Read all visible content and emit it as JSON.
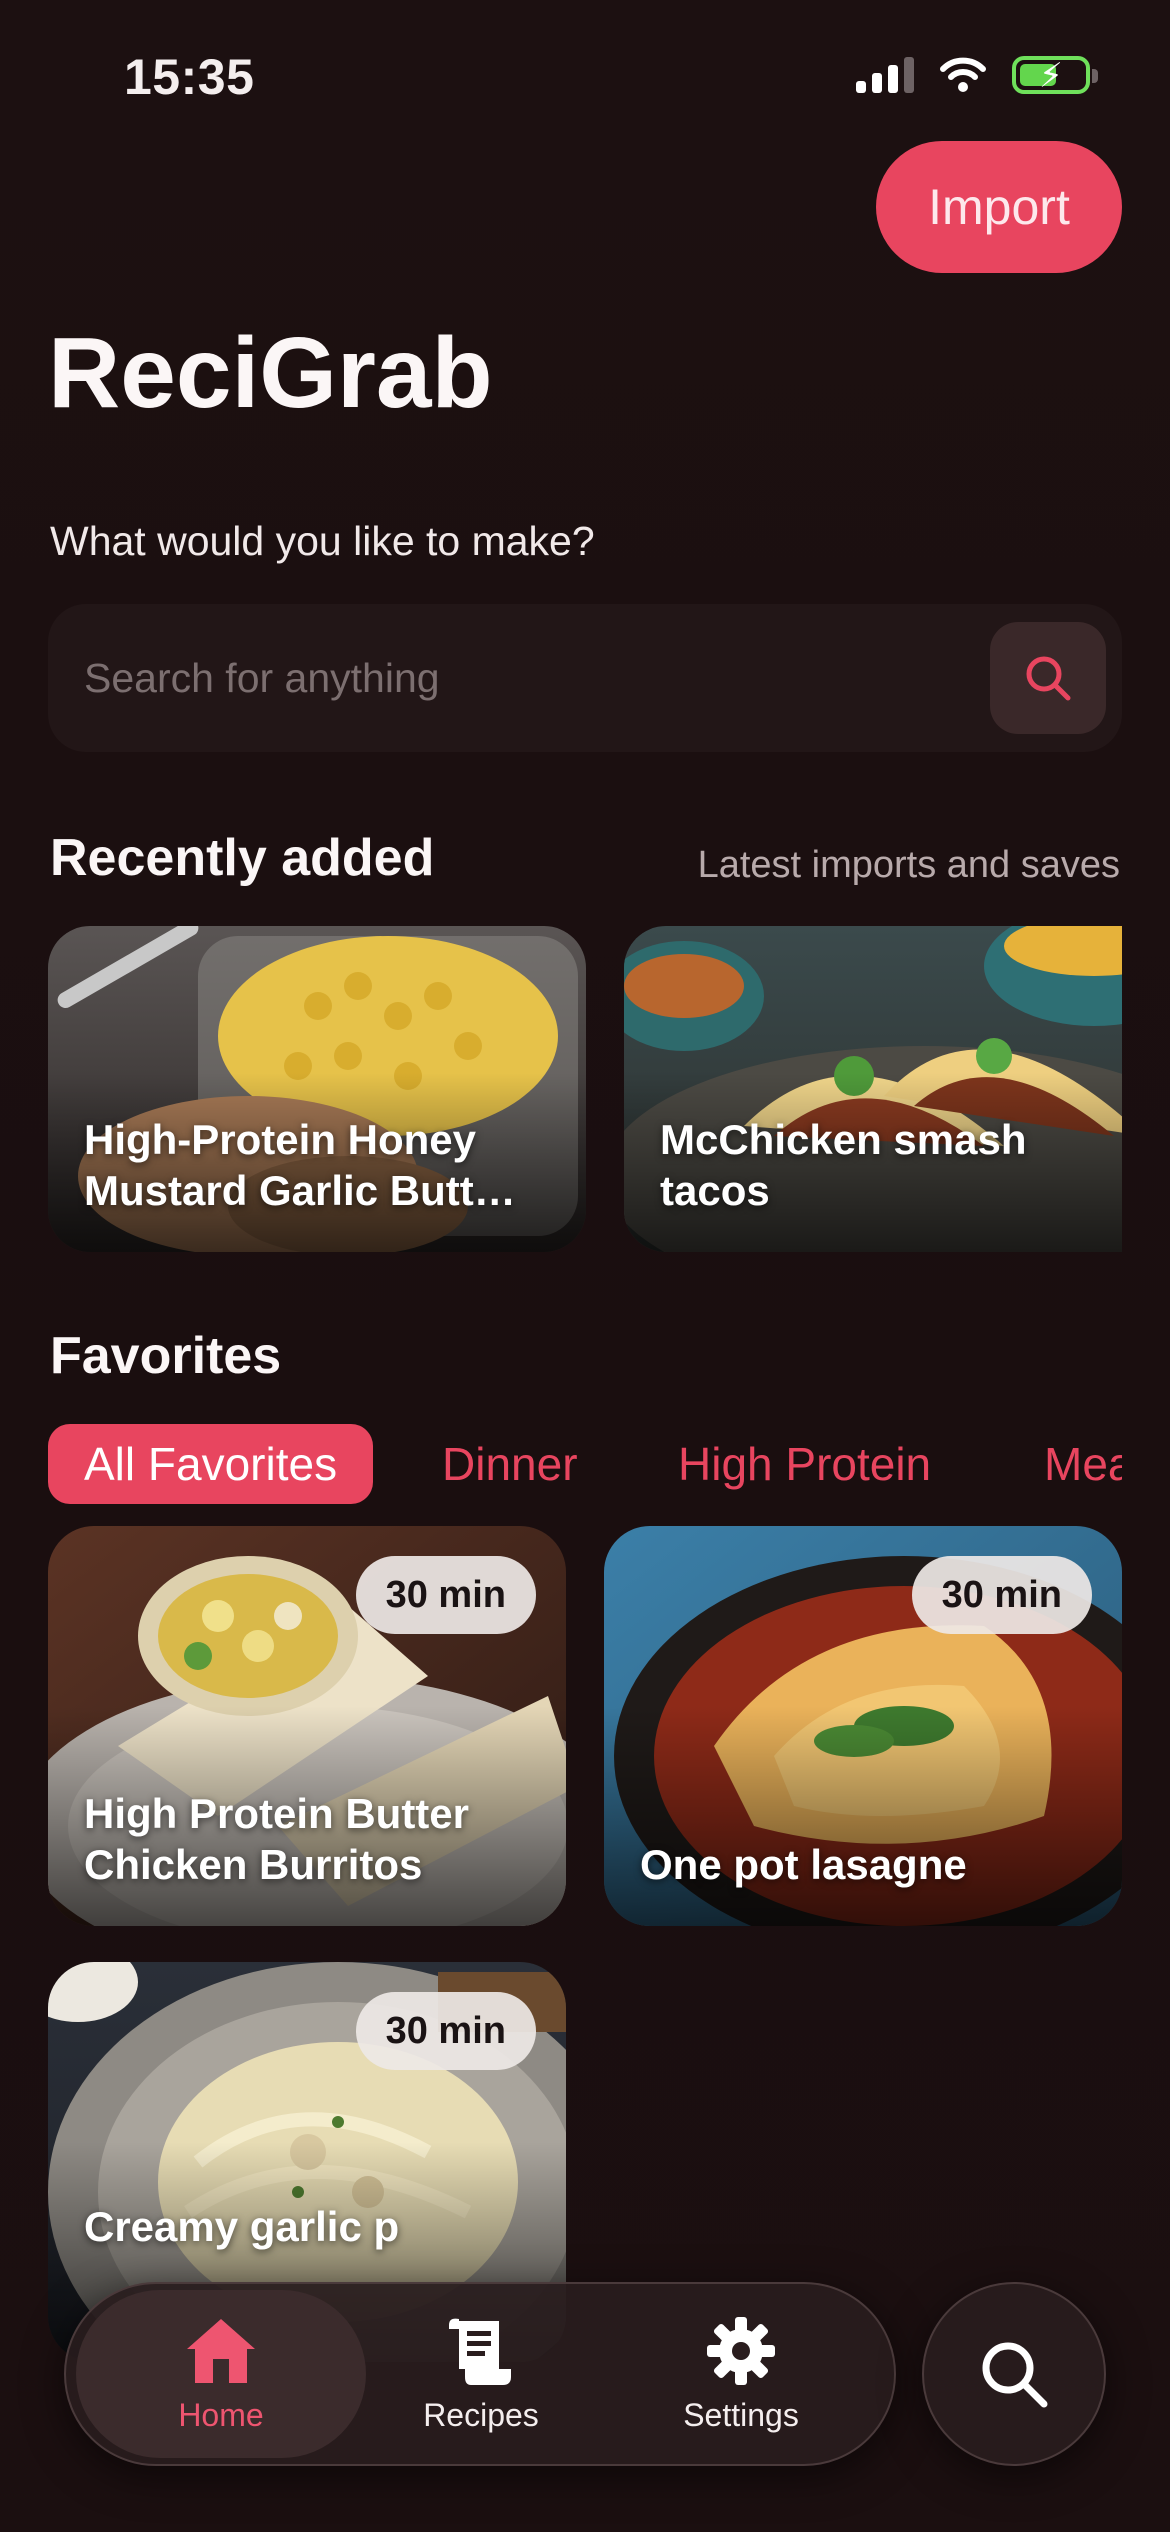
{
  "status_bar": {
    "time": "15:35"
  },
  "header": {
    "import_label": "Import",
    "app_title": "ReciGrab",
    "prompt": "What would you like to make?"
  },
  "search": {
    "placeholder": "Search for anything"
  },
  "recently_added": {
    "title": "Recently added",
    "subtitle": "Latest imports and saves",
    "items": [
      {
        "title": "High-Protein Honey Mustard Garlic Butt…"
      },
      {
        "title": "McChicken smash tacos"
      }
    ]
  },
  "favorites": {
    "title": "Favorites",
    "filters": [
      "All Favorites",
      "Dinner",
      "High Protein",
      "Mea"
    ],
    "active_filter": "All Favorites",
    "items": [
      {
        "title": "High Protein Butter Chicken Burritos",
        "time": "30 min"
      },
      {
        "title": "One pot lasagne",
        "time": "30 min"
      },
      {
        "title": "Creamy garlic p",
        "time": "30 min"
      }
    ]
  },
  "nav": {
    "items": [
      {
        "label": "Home",
        "icon": "home-icon",
        "active": true
      },
      {
        "label": "Recipes",
        "icon": "scroll-icon",
        "active": false
      },
      {
        "label": "Settings",
        "icon": "gear-icon",
        "active": false
      }
    ],
    "search_icon": "search-icon"
  },
  "colors": {
    "accent": "#e8455f",
    "background": "#1b0f10",
    "surface": "#221617"
  }
}
